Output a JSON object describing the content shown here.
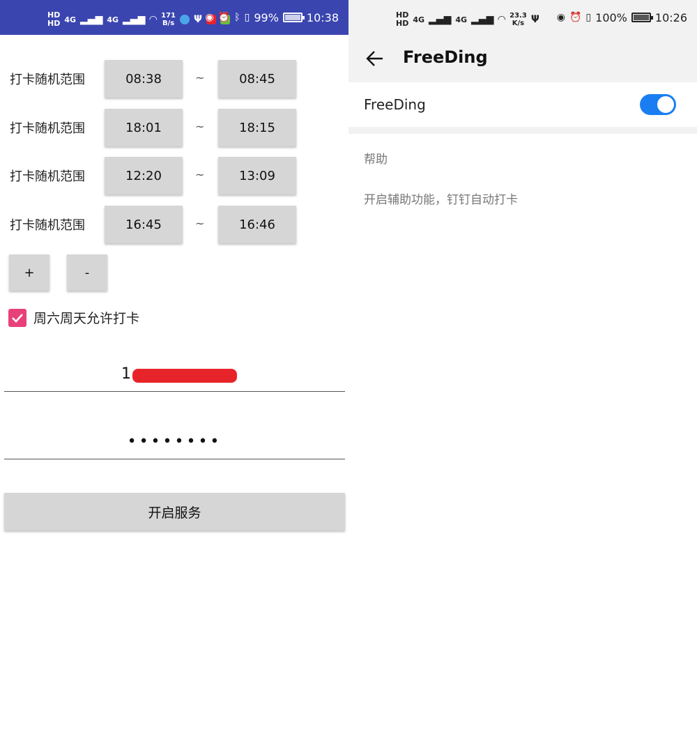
{
  "left": {
    "status": {
      "net_speed_value": "171",
      "net_speed_unit": "B/s",
      "battery": "99%",
      "battery_level": 0.99,
      "time": "10:38",
      "signal_1": "4G",
      "signal_2": "4G",
      "hd_1": "HD",
      "hd_2": "HD"
    },
    "ranges": [
      {
        "label": "打卡随机范围",
        "from": "08:38",
        "to": "08:45"
      },
      {
        "label": "打卡随机范围",
        "from": "18:01",
        "to": "18:15"
      },
      {
        "label": "打卡随机范围",
        "from": "12:20",
        "to": "13:09"
      },
      {
        "label": "打卡随机范围",
        "from": "16:45",
        "to": "16:46"
      }
    ],
    "separator": "~",
    "add_label": "+",
    "remove_label": "-",
    "weekend_label": "周六周天允许打卡",
    "weekend_checked": true,
    "phone_value": "1",
    "password_value": "••••••••",
    "start_label": "开启服务"
  },
  "right": {
    "status": {
      "net_speed_value": "23.3",
      "net_speed_unit": "K/s",
      "battery": "100%",
      "battery_level": 1.0,
      "time": "10:26",
      "signal_1": "4G",
      "signal_2": "4G",
      "hd_1": "HD",
      "hd_2": "HD"
    },
    "title": "FreeDing",
    "setting_label": "FreeDing",
    "toggle_on": true,
    "section_header": "帮助",
    "help_text": "开启辅助功能，钉钉自动打卡"
  },
  "colors": {
    "left_statusbar": "#3a45b0",
    "checkbox": "#e8407a",
    "toggle_on": "#1a7ef2",
    "button_gray": "#d6d6d6"
  }
}
